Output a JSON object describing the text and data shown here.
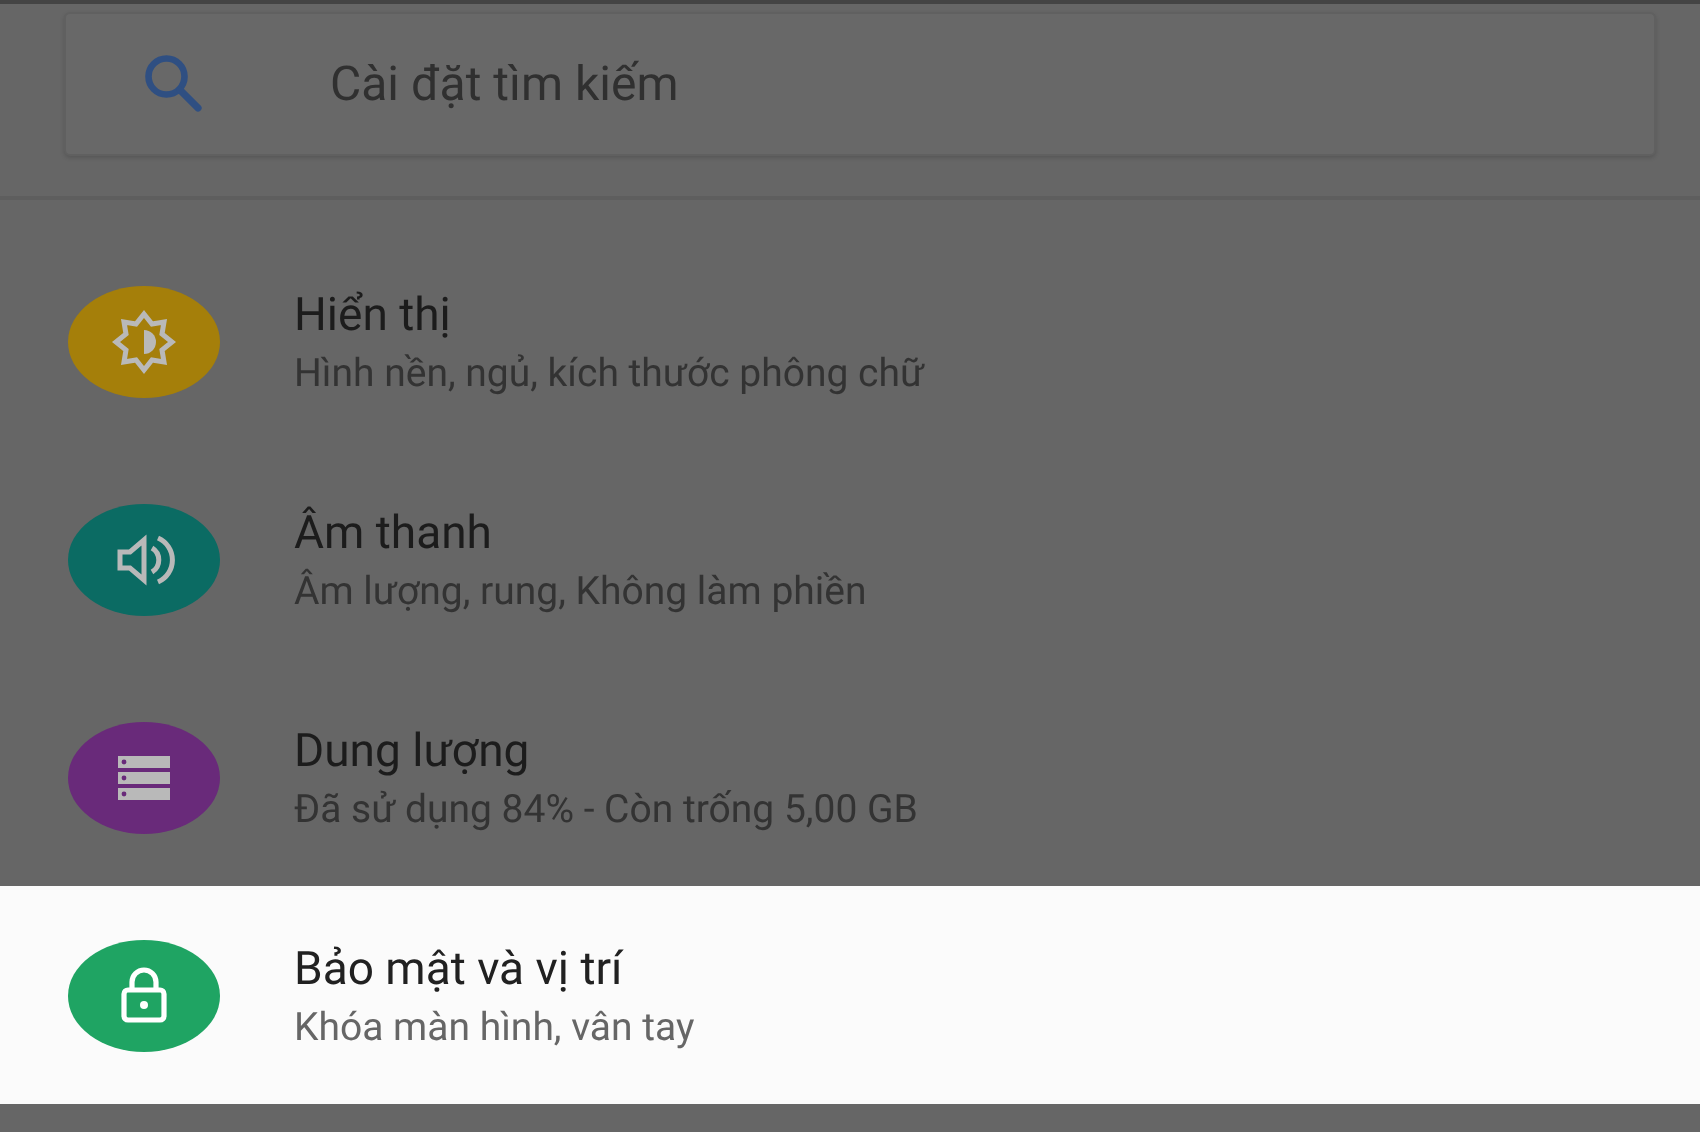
{
  "search": {
    "placeholder": "Cài đặt tìm kiếm"
  },
  "items": [
    {
      "kind": "display",
      "title": "Hiển thị",
      "subtitle": "Hình nền, ngủ, kích thước phông chữ",
      "color": "#a57f0a",
      "highlighted": false
    },
    {
      "kind": "sound",
      "title": "Âm thanh",
      "subtitle": "Âm lượng, rung, Không làm phiền",
      "color": "#0b6b63",
      "highlighted": false
    },
    {
      "kind": "storage",
      "title": "Dung lượng",
      "subtitle": "Đã sử dụng 84% - Còn trống 5,00 GB",
      "color": "#692a7a",
      "highlighted": false
    },
    {
      "kind": "security",
      "title": "Bảo mật và vị trí",
      "subtitle": "Khóa màn hình, vân tay",
      "color": "#1fa463",
      "highlighted": true
    }
  ]
}
